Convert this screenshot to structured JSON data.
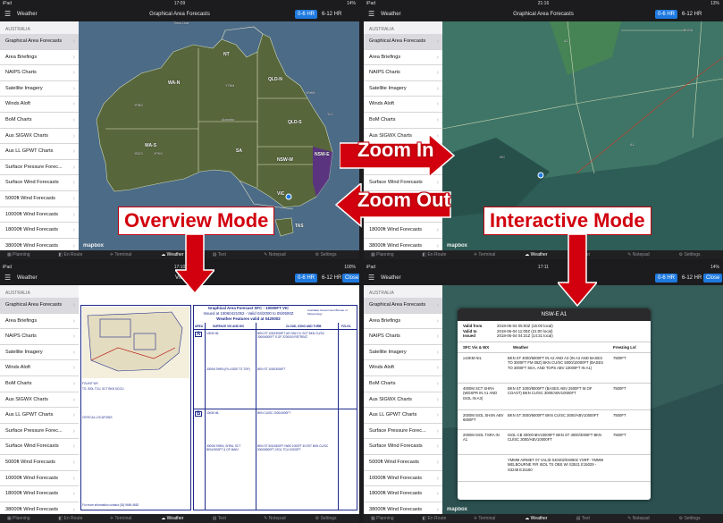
{
  "status": {
    "tl": {
      "left": "iPad",
      "center": "17:09",
      "right": "14%"
    },
    "tr": {
      "left": "iPad",
      "center": "21:16",
      "right": "13%"
    },
    "bl": {
      "left": "iPad",
      "center": "17:10",
      "right": "100%"
    },
    "br": {
      "left": "iPad",
      "center": "17:11",
      "right": "14%"
    }
  },
  "nav": {
    "sidebar_title": "Weather",
    "map_title": "Graphical Area Forecasts",
    "doc_title": "VIC",
    "popup_title": "NSW-E A1",
    "seg_0_6": "0-6 HR",
    "seg_6_12": "6-12 HR",
    "close": "Close"
  },
  "sidebar": {
    "header": "AUSTRALIA",
    "items": [
      "Graphical Area Forecasts",
      "Area Briefings",
      "NAIPS Charts",
      "Satellite Imagery",
      "Winds Aloft",
      "BoM Charts",
      "Aus SIGWX Charts",
      "Aus LL GPWT Charts",
      "Surface Pressure Forec...",
      "Surface Wind Forecasts",
      "5000ft Wind Forecasts",
      "10000ft Wind Forecasts",
      "18000ft Wind Forecasts",
      "38000ft Wind Forecasts"
    ],
    "items_tl_trunc": "Surface Pressure Forec...",
    "items_tr_trunc": "Surface Pressure Foreca..."
  },
  "tabs": [
    "Planning",
    "En Route",
    "Terminal",
    "Weather",
    "Text",
    "Notepad",
    "Settings"
  ],
  "map_labels": {
    "top": "Timor Leat",
    "nt": "NT",
    "wa_n": "WA-N",
    "qld_n": "QLD-N",
    "qld_s": "QLD-S",
    "sa": "SA",
    "wa_s": "WA-S",
    "nsw_w": "NSW-W",
    "nsw_e": "NSW-E",
    "vic": "VIC",
    "tas": "TAS",
    "australia": "Australia",
    "ytnm": "YTNM",
    "ybhm": "YBHM",
    "ycfo": "YPBO",
    "ybcs": "YBCS",
    "ypkg": "YPKG",
    "ylc": "YLC",
    "a2": "A2",
    "a1": "A1",
    "buga": "BUGA",
    "vic2": "VIC"
  },
  "annotations": {
    "zoom_in": "Zoom In",
    "zoom_out": "Zoom Out",
    "overview": "Overview Mode",
    "interactive": "Interactive Mode"
  },
  "mapbox": "mapbox",
  "doc": {
    "title1": "Graphical Area Forecast SFC - 10000FT VIC",
    "title2": "Issued at 18060421052 - Valid 04/2000 to 05/0500Z",
    "title3": "Weather Features valid at 0420002",
    "agency": "Australian Government Bureau of Meteorology",
    "col_area": "AREA",
    "col_vis": "SURFACE VIS AND WX",
    "col_cloud": "CLOUD, ICING AND TURB",
    "col_fz": "FZL/VL",
    "area_a": "A",
    "area_b": "B",
    "r1_vis": "10KM NIL",
    "r1_cloud": "BKN ST 1000/3000FT AS ONLY N. SCT BKN CU/SC 3000/6000FT S OF 3700000 RETREAT",
    "r2_vis": "3000M SHRA (FILLSIDE TO TOP)",
    "r2_cloud": "BKN ST 1000/3000FT",
    "r3_vis": "10KM NIL",
    "r3_cloud": "BKN CU/SC 2000/4000FT",
    "r4_vis": "3000M SHRA, SHRA, SCT BKN/1500FT & OF MAIN",
    "r4_cloud": "BKN ST 500/1800FT NWD 1000FT IN EST BKN CU/SC 5000/8000FT, ISOL TCU 10000FT",
    "legend1": "FZL/INT WX",
    "legend2": "TS: ISOL TCU, SCT BKN SC/CU",
    "legend3": "CRITICAL LOCATIONS",
    "footer": "For more information contact (03) 9669 4852"
  },
  "popup": {
    "valid_from_k": "Valid from",
    "valid_from_v": "2018-06-04 05:00Z (15:00 local)",
    "valid_to_k": "Valid to",
    "valid_to_v": "2018-06-04 11:00Z (21:00 local)",
    "issued_k": "Issued",
    "issued_v": "2018-06-04 04:31Z (14:31 local)",
    "h1": "SFC Vis & WX",
    "h2": "Weather",
    "h3": "Freezing Lvl",
    "rows": [
      {
        "vis": "≥10KM NIL",
        "wx": "BKN ST 4000/6000FT IN A2 AND A3 (IN A4 AND BASES TO 3000FT FM 08Z) BKN CU/SC 5000/10000FT (BASES TO 3000FT SEA, AND TOPS ABV 10000FT IN A1)",
        "fz": "7500FT"
      },
      {
        "vis": "4000M SCT SHRA (WDSPR IN A1 AND ISOL IN A3)",
        "wx": "BKN ST 1000/8000FT (BASES ABV 2500FT W OF COAST) BKN CU/SC 3000/ABV10000FT",
        "fz": "7500FT"
      },
      {
        "vis": "2000M ISOL SHSN ABV 6000FT",
        "wx": "BKN ST 3000/6000FT BKN CU/SC 3000/ABV10000FT",
        "fz": "7500FT"
      },
      {
        "vis": "2000M ISOL TSRA IN A1",
        "wx": "ISOL CB 3000/ABV10000FT BKN ST 3000/3000FT BKN CU/SC 3000/ABV10000FT",
        "fz": "7500FT"
      },
      {
        "vis": "",
        "wx": "YMMM AIRMET 07 VALID 040402/040802 YSRF- YMMM MELBOURNE FIR ISOL TS OBS WI S3521 E15029 - S3248 E15150",
        "fz": ""
      }
    ]
  },
  "colors": {
    "accent": "#1f7ae0",
    "annotation_red": "#d2000e",
    "map_water": "#4c6b87",
    "map_land": "#57663b"
  }
}
